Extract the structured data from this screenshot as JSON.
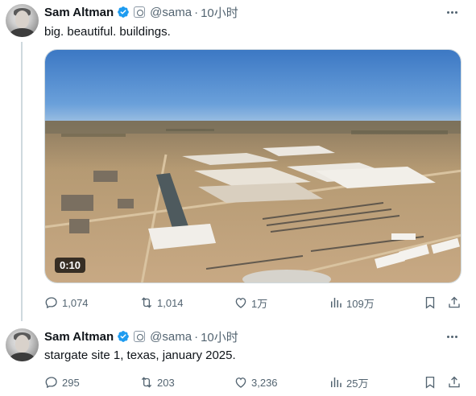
{
  "tweets": [
    {
      "author_name": "Sam Altman",
      "handle": "@sama",
      "separator": "·",
      "time": "10小时",
      "text": "big. beautiful. buildings.",
      "video_duration": "0:10",
      "stats": {
        "replies": "1,074",
        "retweets": "1,014",
        "likes": "1万",
        "views": "109万"
      }
    },
    {
      "author_name": "Sam Altman",
      "handle": "@sama",
      "separator": "·",
      "time": "10小时",
      "text": "stargate site 1, texas, january 2025.",
      "stats": {
        "replies": "295",
        "retweets": "203",
        "likes": "3,236",
        "views": "25万"
      }
    }
  ],
  "colors": {
    "verified": "#1d9bf0",
    "muted": "#536471",
    "text": "#0f1419"
  },
  "icons": [
    "verified-badge-icon",
    "org-badge-icon",
    "more-icon",
    "reply-icon",
    "retweet-icon",
    "like-icon",
    "views-icon",
    "bookmark-icon",
    "share-icon"
  ]
}
